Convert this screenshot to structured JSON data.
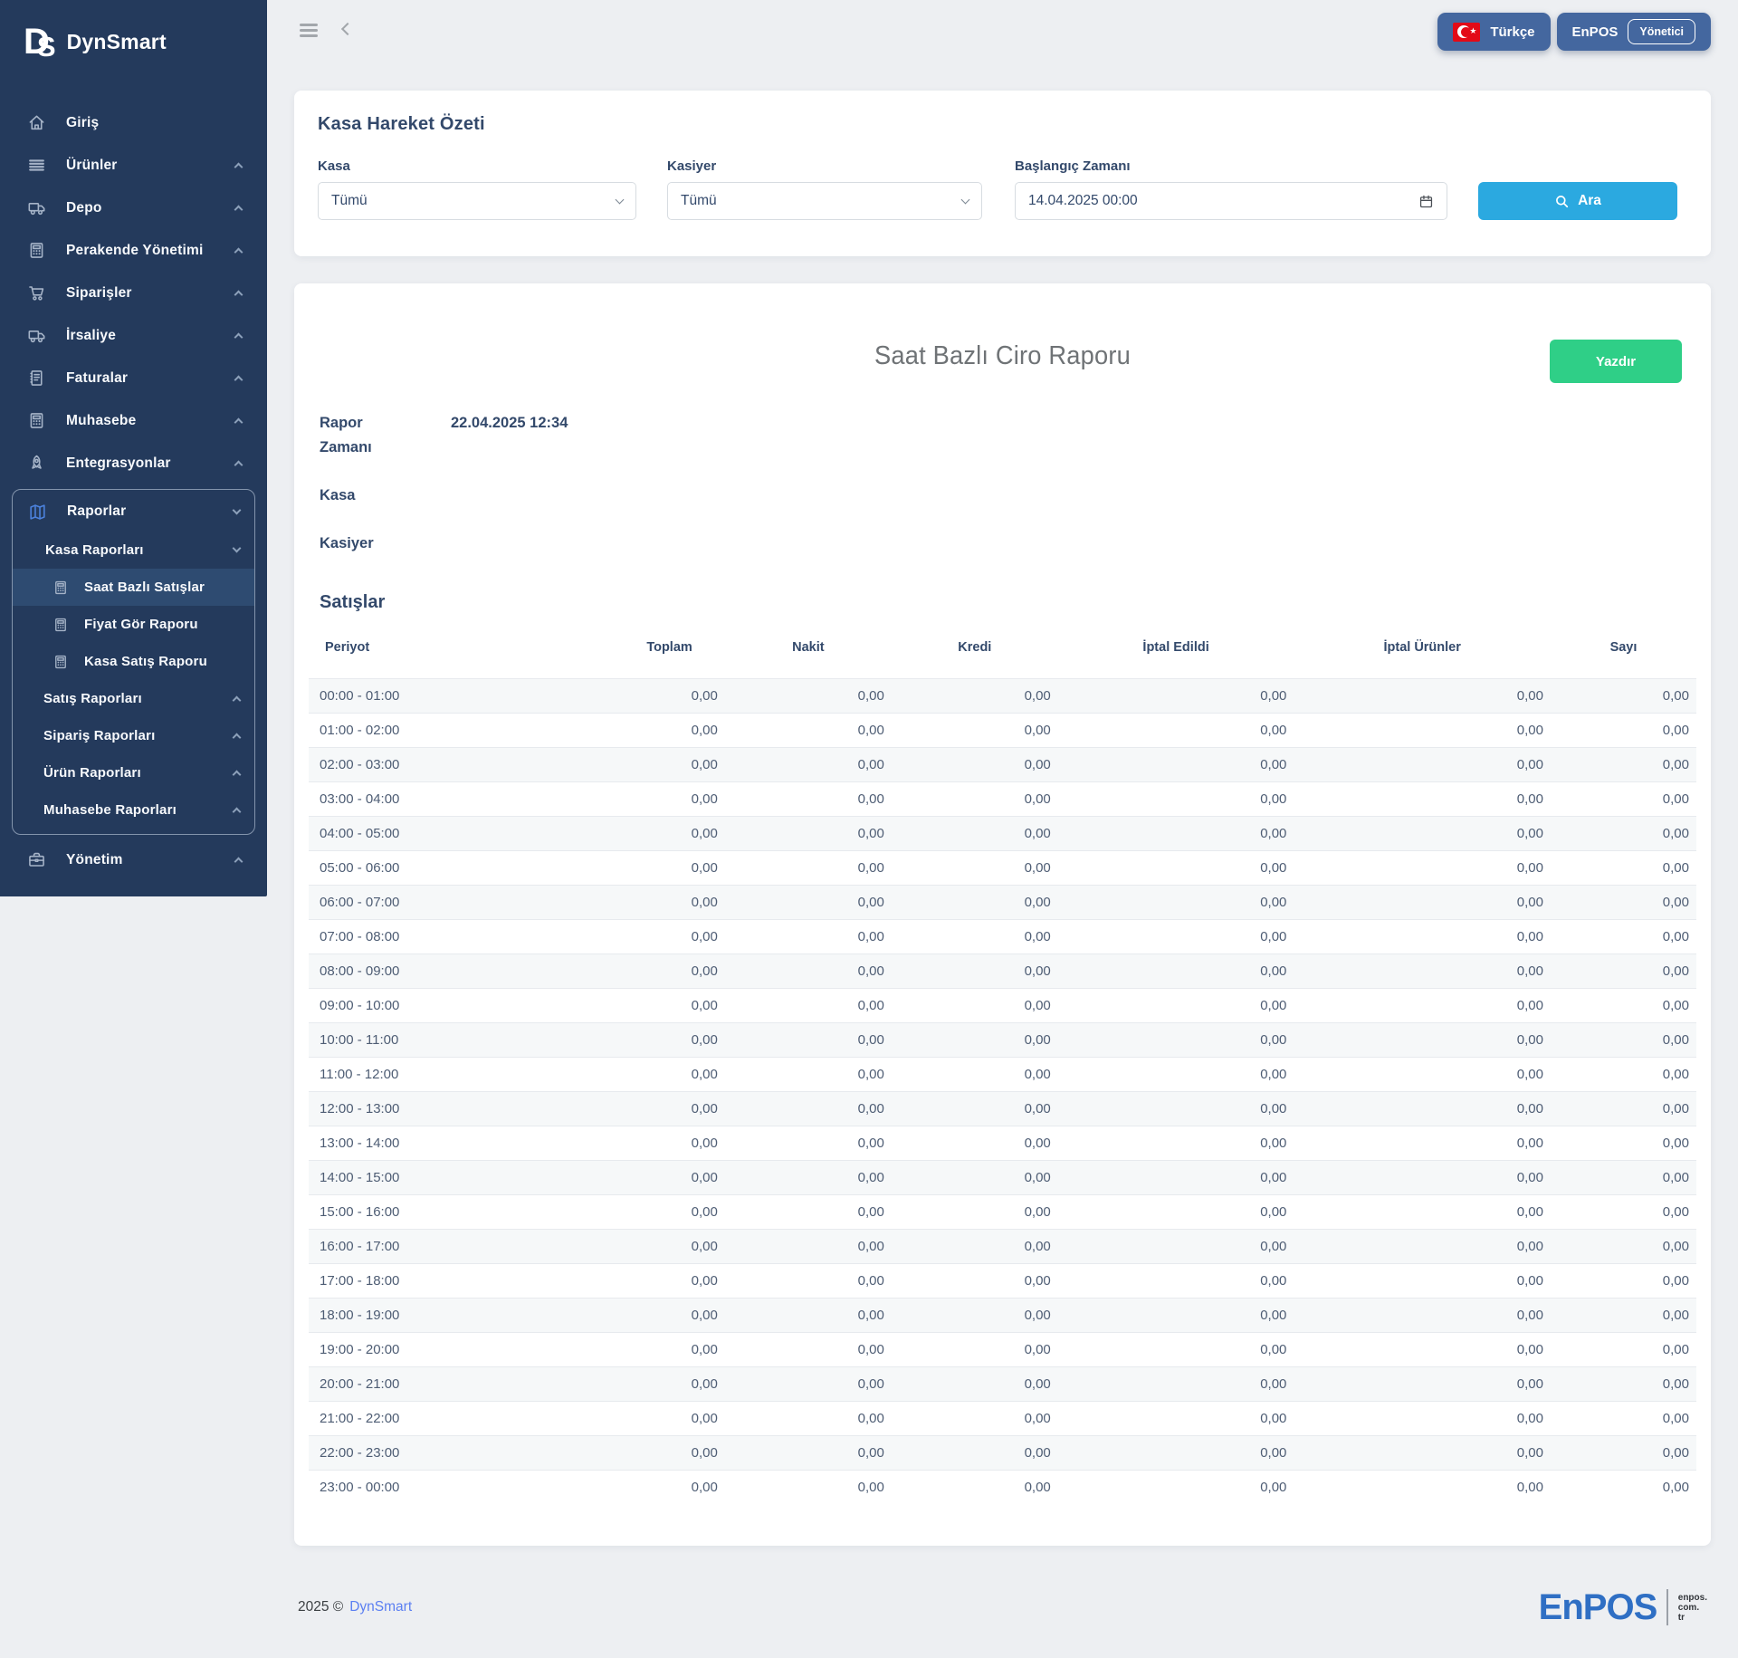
{
  "colors": {
    "sidebar_bg": "#243a5c",
    "sidebar_active": "#2e4b71",
    "accent_blue": "#2ba9e0",
    "accent_green": "#2fcf87",
    "button_navy": "#44679f",
    "enpos_blue": "#2f6fc4",
    "flag_red": "#e30a17",
    "heading_navy": "#33496b",
    "page_bg": "#edeff2"
  },
  "sidebar": {
    "logo_d": "D",
    "logo_s": "S",
    "brand": "DynSmart",
    "items": [
      {
        "label": "Giriş",
        "icon": "home-icon"
      },
      {
        "label": "Ürünler",
        "icon": "list-icon"
      },
      {
        "label": "Depo",
        "icon": "truck-icon"
      },
      {
        "label": "Perakende Yönetimi",
        "icon": "calculator-icon"
      },
      {
        "label": "Siparişler",
        "icon": "cart-icon"
      },
      {
        "label": "İrsaliye",
        "icon": "truck-icon"
      },
      {
        "label": "Faturalar",
        "icon": "invoice-icon"
      },
      {
        "label": "Muhasebe",
        "icon": "calculator-icon"
      },
      {
        "label": "Entegrasyonlar",
        "icon": "rocket-icon"
      }
    ],
    "reports": {
      "label": "Raporlar",
      "icon": "map-icon",
      "kasa_group_label": "Kasa Raporları",
      "kasa_items": [
        "Saat Bazlı Satışlar",
        "Fiyat Gör Raporu",
        "Kasa Satış Raporu"
      ],
      "active_item": "Saat Bazlı Satışlar",
      "collapsed_groups": [
        "Satış Raporları",
        "Sipariş Raporları",
        "Ürün Raporları",
        "Muhasebe Raporları"
      ]
    },
    "yonetim_label": "Yönetim"
  },
  "topbar": {
    "language_label": "Türkçe",
    "brand_label": "EnPOS",
    "role_label": "Yönetici"
  },
  "filter": {
    "title": "Kasa Hareket Özeti",
    "kasa_label": "Kasa",
    "kasa_value": "Tümü",
    "kasiyer_label": "Kasiyer",
    "kasiyer_value": "Tümü",
    "start_label": "Başlangıç Zamanı",
    "start_value": "14.04.2025 00:00",
    "search_label": "Ara"
  },
  "report": {
    "title": "Saat Bazlı Ciro Raporu",
    "print_label": "Yazdır",
    "meta": {
      "rapor_zamani_label": "Rapor Zamanı",
      "rapor_zamani_value": "22.04.2025 12:34",
      "kasa_label": "Kasa",
      "kasa_value": "",
      "kasiyer_label": "Kasiyer",
      "kasiyer_value": ""
    },
    "section_title": "Satışlar",
    "table": {
      "columns": [
        "Periyot",
        "Toplam",
        "Nakit",
        "Kredi",
        "İptal Edildi",
        "İptal Ürünler",
        "Sayı"
      ],
      "rows": [
        {
          "periyot": "00:00 - 01:00",
          "toplam": "0,00",
          "nakit": "0,00",
          "kredi": "0,00",
          "iptal_edildi": "0,00",
          "iptal_urunler": "0,00",
          "sayi": "0,00"
        },
        {
          "periyot": "01:00 - 02:00",
          "toplam": "0,00",
          "nakit": "0,00",
          "kredi": "0,00",
          "iptal_edildi": "0,00",
          "iptal_urunler": "0,00",
          "sayi": "0,00"
        },
        {
          "periyot": "02:00 - 03:00",
          "toplam": "0,00",
          "nakit": "0,00",
          "kredi": "0,00",
          "iptal_edildi": "0,00",
          "iptal_urunler": "0,00",
          "sayi": "0,00"
        },
        {
          "periyot": "03:00 - 04:00",
          "toplam": "0,00",
          "nakit": "0,00",
          "kredi": "0,00",
          "iptal_edildi": "0,00",
          "iptal_urunler": "0,00",
          "sayi": "0,00"
        },
        {
          "periyot": "04:00 - 05:00",
          "toplam": "0,00",
          "nakit": "0,00",
          "kredi": "0,00",
          "iptal_edildi": "0,00",
          "iptal_urunler": "0,00",
          "sayi": "0,00"
        },
        {
          "periyot": "05:00 - 06:00",
          "toplam": "0,00",
          "nakit": "0,00",
          "kredi": "0,00",
          "iptal_edildi": "0,00",
          "iptal_urunler": "0,00",
          "sayi": "0,00"
        },
        {
          "periyot": "06:00 - 07:00",
          "toplam": "0,00",
          "nakit": "0,00",
          "kredi": "0,00",
          "iptal_edildi": "0,00",
          "iptal_urunler": "0,00",
          "sayi": "0,00"
        },
        {
          "periyot": "07:00 - 08:00",
          "toplam": "0,00",
          "nakit": "0,00",
          "kredi": "0,00",
          "iptal_edildi": "0,00",
          "iptal_urunler": "0,00",
          "sayi": "0,00"
        },
        {
          "periyot": "08:00 - 09:00",
          "toplam": "0,00",
          "nakit": "0,00",
          "kredi": "0,00",
          "iptal_edildi": "0,00",
          "iptal_urunler": "0,00",
          "sayi": "0,00"
        },
        {
          "periyot": "09:00 - 10:00",
          "toplam": "0,00",
          "nakit": "0,00",
          "kredi": "0,00",
          "iptal_edildi": "0,00",
          "iptal_urunler": "0,00",
          "sayi": "0,00"
        },
        {
          "periyot": "10:00 - 11:00",
          "toplam": "0,00",
          "nakit": "0,00",
          "kredi": "0,00",
          "iptal_edildi": "0,00",
          "iptal_urunler": "0,00",
          "sayi": "0,00"
        },
        {
          "periyot": "11:00 - 12:00",
          "toplam": "0,00",
          "nakit": "0,00",
          "kredi": "0,00",
          "iptal_edildi": "0,00",
          "iptal_urunler": "0,00",
          "sayi": "0,00"
        },
        {
          "periyot": "12:00 - 13:00",
          "toplam": "0,00",
          "nakit": "0,00",
          "kredi": "0,00",
          "iptal_edildi": "0,00",
          "iptal_urunler": "0,00",
          "sayi": "0,00"
        },
        {
          "periyot": "13:00 - 14:00",
          "toplam": "0,00",
          "nakit": "0,00",
          "kredi": "0,00",
          "iptal_edildi": "0,00",
          "iptal_urunler": "0,00",
          "sayi": "0,00"
        },
        {
          "periyot": "14:00 - 15:00",
          "toplam": "0,00",
          "nakit": "0,00",
          "kredi": "0,00",
          "iptal_edildi": "0,00",
          "iptal_urunler": "0,00",
          "sayi": "0,00"
        },
        {
          "periyot": "15:00 - 16:00",
          "toplam": "0,00",
          "nakit": "0,00",
          "kredi": "0,00",
          "iptal_edildi": "0,00",
          "iptal_urunler": "0,00",
          "sayi": "0,00"
        },
        {
          "periyot": "16:00 - 17:00",
          "toplam": "0,00",
          "nakit": "0,00",
          "kredi": "0,00",
          "iptal_edildi": "0,00",
          "iptal_urunler": "0,00",
          "sayi": "0,00"
        },
        {
          "periyot": "17:00 - 18:00",
          "toplam": "0,00",
          "nakit": "0,00",
          "kredi": "0,00",
          "iptal_edildi": "0,00",
          "iptal_urunler": "0,00",
          "sayi": "0,00"
        },
        {
          "periyot": "18:00 - 19:00",
          "toplam": "0,00",
          "nakit": "0,00",
          "kredi": "0,00",
          "iptal_edildi": "0,00",
          "iptal_urunler": "0,00",
          "sayi": "0,00"
        },
        {
          "periyot": "19:00 - 20:00",
          "toplam": "0,00",
          "nakit": "0,00",
          "kredi": "0,00",
          "iptal_edildi": "0,00",
          "iptal_urunler": "0,00",
          "sayi": "0,00"
        },
        {
          "periyot": "20:00 - 21:00",
          "toplam": "0,00",
          "nakit": "0,00",
          "kredi": "0,00",
          "iptal_edildi": "0,00",
          "iptal_urunler": "0,00",
          "sayi": "0,00"
        },
        {
          "periyot": "21:00 - 22:00",
          "toplam": "0,00",
          "nakit": "0,00",
          "kredi": "0,00",
          "iptal_edildi": "0,00",
          "iptal_urunler": "0,00",
          "sayi": "0,00"
        },
        {
          "periyot": "22:00 - 23:00",
          "toplam": "0,00",
          "nakit": "0,00",
          "kredi": "0,00",
          "iptal_edildi": "0,00",
          "iptal_urunler": "0,00",
          "sayi": "0,00"
        },
        {
          "periyot": "23:00 - 00:00",
          "toplam": "0,00",
          "nakit": "0,00",
          "kredi": "0,00",
          "iptal_edildi": "0,00",
          "iptal_urunler": "0,00",
          "sayi": "0,00"
        }
      ]
    }
  },
  "footer": {
    "copyright": "2025 ©",
    "brand_link": "DynSmart",
    "logo_text": "EnPOS",
    "logo_domain": [
      "enpos.",
      "com.",
      "tr"
    ]
  }
}
